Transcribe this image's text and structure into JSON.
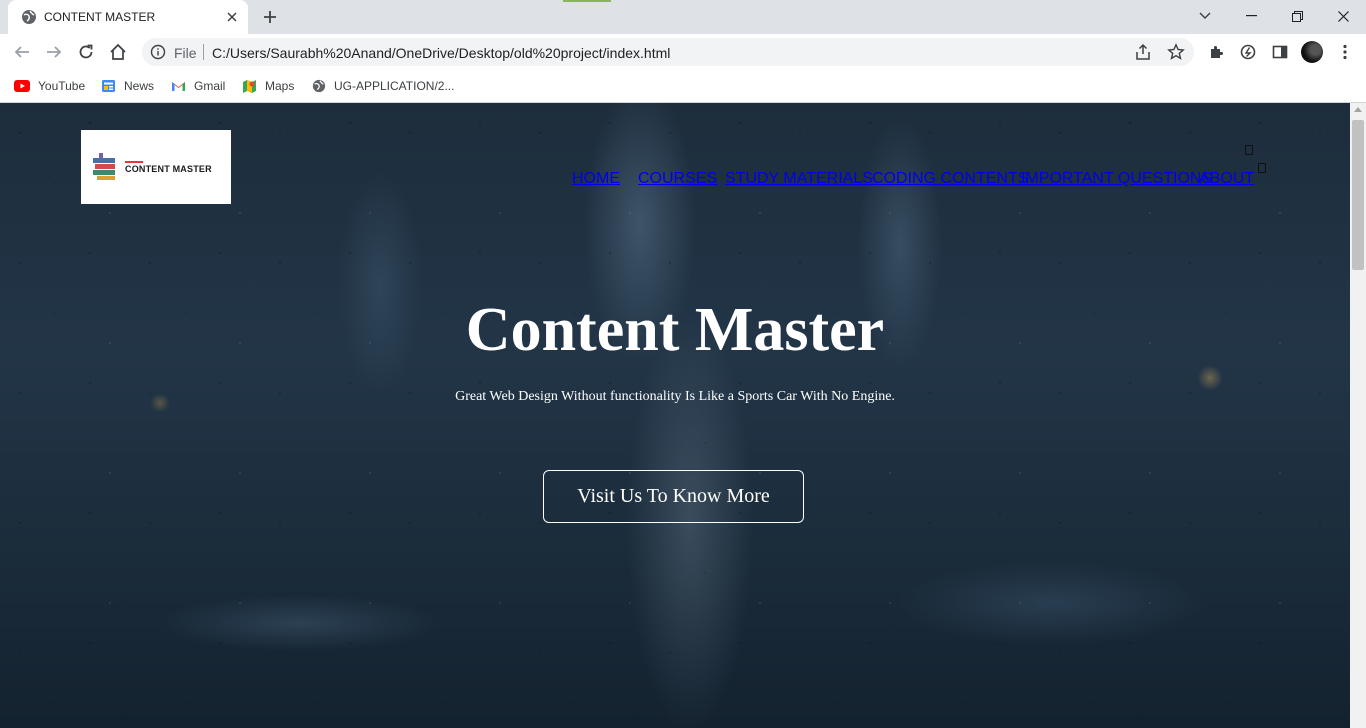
{
  "browser": {
    "tab": {
      "title": "CONTENT MASTER"
    },
    "omnibox": {
      "scheme": "File",
      "url": "C:/Users/Saurabh%20Anand/OneDrive/Desktop/old%20project/index.html"
    },
    "bookmarks": [
      {
        "label": "YouTube",
        "icon": "youtube-icon"
      },
      {
        "label": "News",
        "icon": "news-icon"
      },
      {
        "label": "Gmail",
        "icon": "gmail-icon"
      },
      {
        "label": "Maps",
        "icon": "maps-icon"
      },
      {
        "label": "UG-APPLICATION/2...",
        "icon": "globe-icon"
      }
    ]
  },
  "site": {
    "logo_text": "CONTENT MASTER",
    "nav": [
      "HOME",
      "COURSES",
      "STUDY MATERIALS",
      "CODING CONTENTS",
      "IMPORTANT QUESTIONS",
      "ABOUT"
    ],
    "hero": {
      "title": "Content Master",
      "subtitle": "Great Web Design Without functionality Is Like a Sports Car With No Engine.",
      "cta_label": "Visit Us To Know More"
    }
  },
  "colors": {
    "tabstrip": "#dee1e6",
    "toolbar": "#ffffff",
    "omnibox": "#f1f3f4",
    "hero_bg": "#1f3142",
    "hero_text": "#ffffff"
  }
}
